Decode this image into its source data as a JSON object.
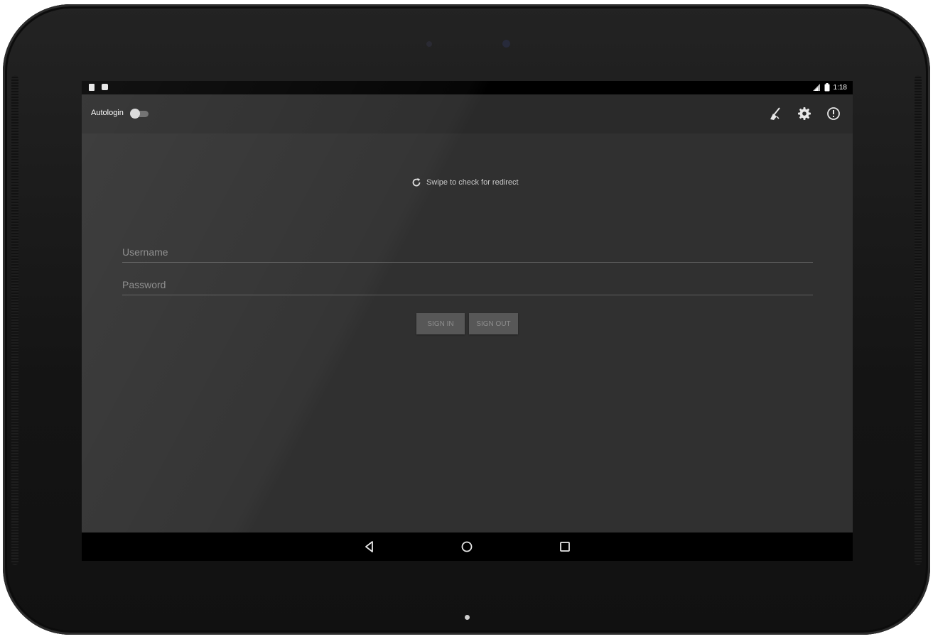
{
  "status_bar": {
    "time": "1:18",
    "left_icons": [
      "sd-card-icon",
      "download-icon"
    ],
    "right_icons": [
      "signal-icon",
      "battery-icon"
    ]
  },
  "toolbar": {
    "autologin_label": "Autologin",
    "autologin_enabled": false,
    "actions": [
      "broom-clean-icon",
      "settings-gear-icon",
      "info-icon"
    ]
  },
  "main": {
    "swipe_hint": "Swipe to check for redirect",
    "username_placeholder": "Username",
    "password_placeholder": "Password",
    "sign_in_label": "SIGN IN",
    "sign_out_label": "SIGN OUT"
  },
  "navigation": {
    "buttons": [
      "back-icon",
      "home-icon",
      "recents-icon"
    ]
  },
  "colors": {
    "screen_bg": "#303030",
    "toolbar_bg": "#2a2a2a",
    "button_bg": "#575757",
    "button_text": "#8d8d8d"
  }
}
